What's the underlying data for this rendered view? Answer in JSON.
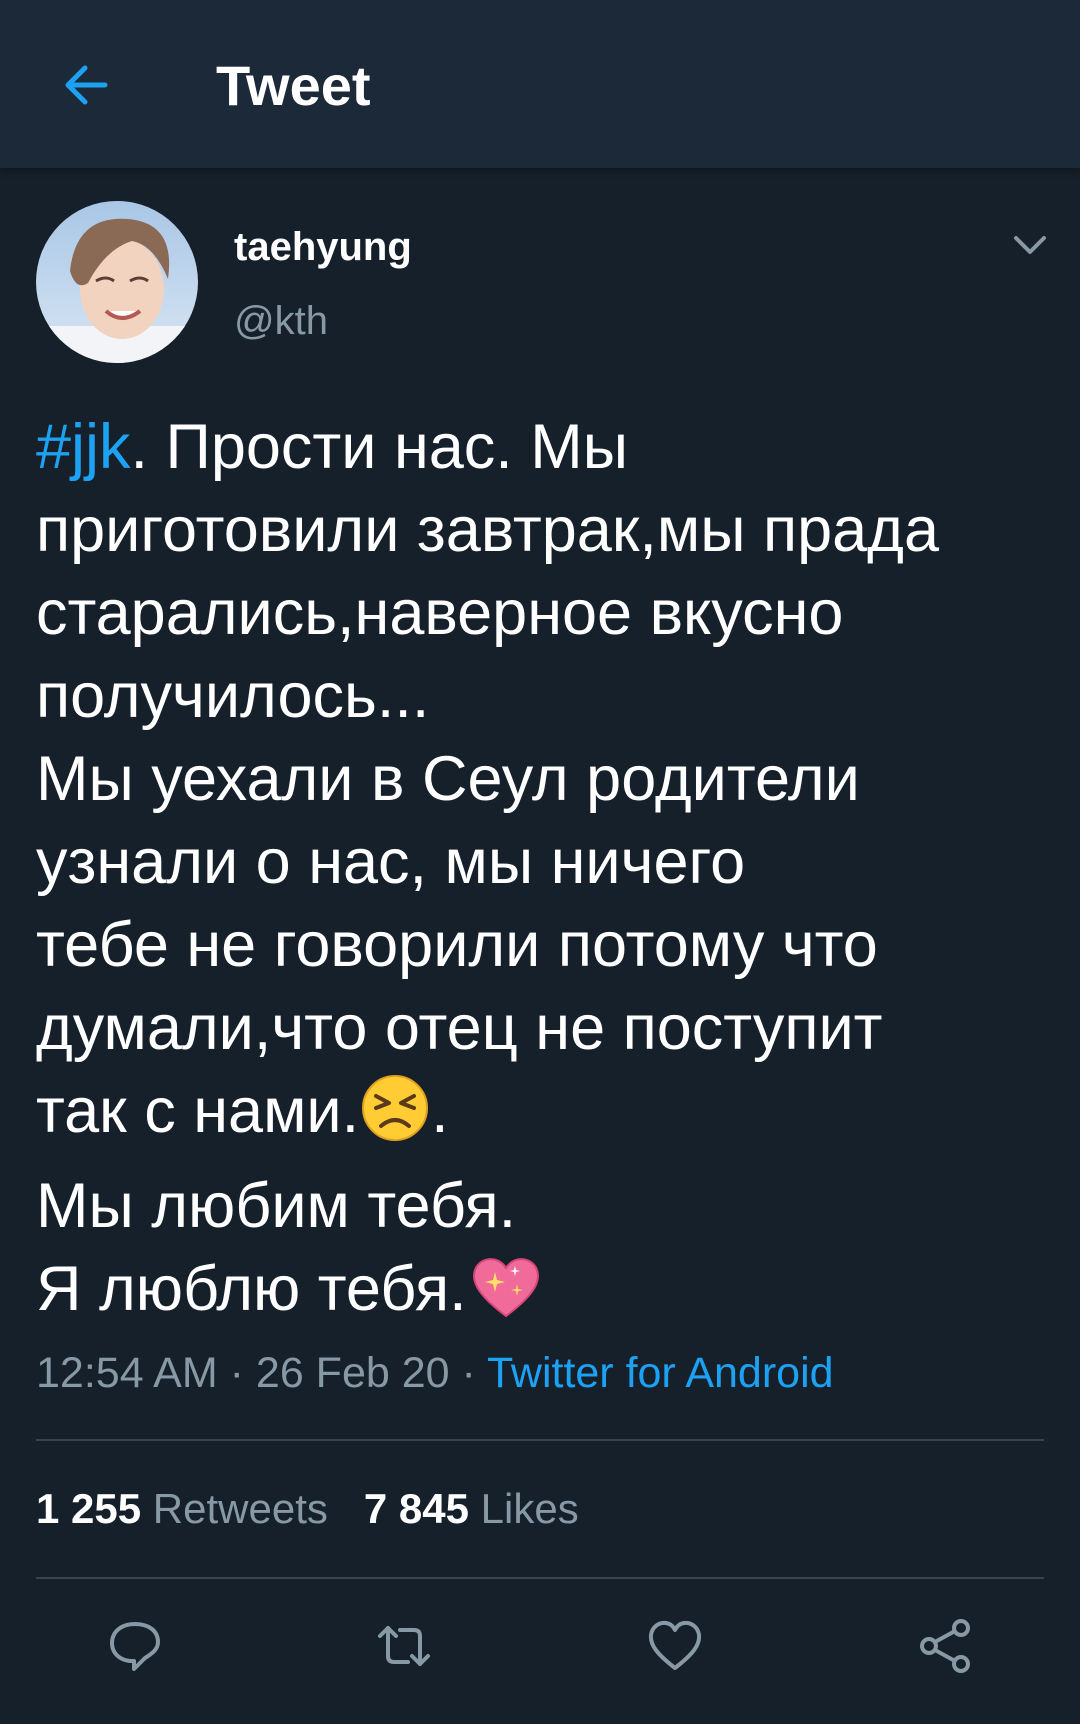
{
  "header": {
    "title": "Tweet",
    "back_icon": "arrow-left-icon"
  },
  "author": {
    "display_name": "taehyung",
    "handle": "@kth",
    "avatar": "profile-photo"
  },
  "tweet": {
    "hashtag": "#jjk",
    "lines": [
      ". Прости нас. Мы",
      "приготовили завтрак,мы прада",
      "старались,наверное вкусно",
      "получилось...",
      "Мы уехали в Сеул родители",
      "узнали о нас, мы ничего",
      "тебе не говорили потому что",
      "думали,что отец не поступит",
      "так с нами.",
      ".",
      "Мы любим тебя.",
      "Я люблю тебя."
    ],
    "emojis": [
      "persevering-face-emoji",
      "sparkling-heart-emoji"
    ]
  },
  "meta": {
    "time": "12:54 AM",
    "separator": " · ",
    "date": "26 Feb 20",
    "source": "Twitter for Android"
  },
  "stats": {
    "retweets_count": "1 255",
    "retweets_label": "Retweets",
    "likes_count": "7 845",
    "likes_label": "Likes"
  },
  "actions": [
    "reply-icon",
    "retweet-icon",
    "like-icon",
    "share-icon"
  ],
  "colors": {
    "background": "#15202b",
    "header_bg": "#1c2938",
    "accent": "#1da1f2",
    "secondary_text": "#8899a6",
    "divider": "#38444d"
  }
}
